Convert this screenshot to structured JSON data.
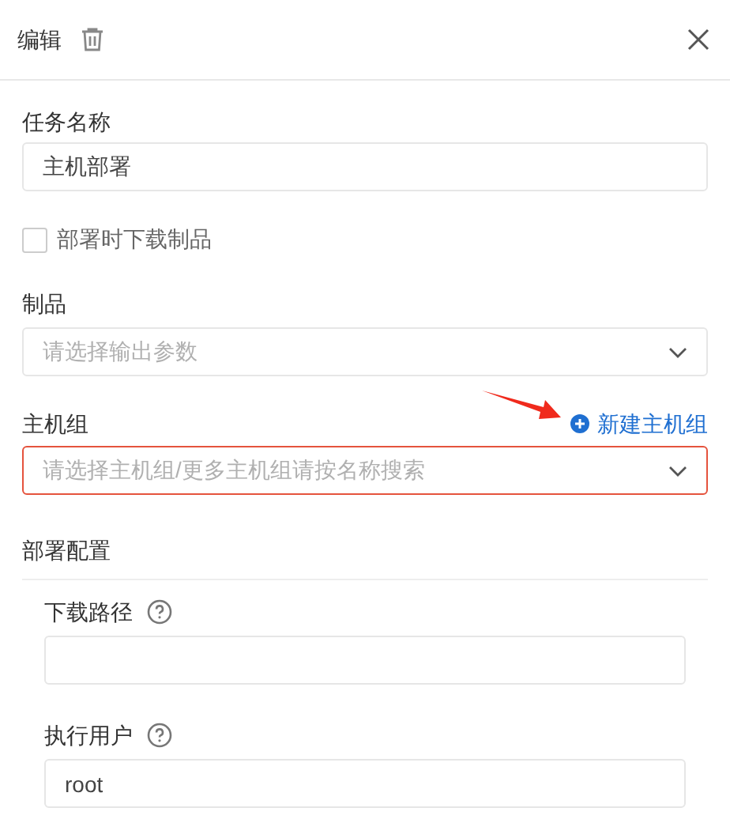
{
  "header": {
    "title": "编辑"
  },
  "task_name": {
    "label": "任务名称",
    "value": "主机部署"
  },
  "download_option": {
    "label": "部署时下载制品",
    "checked": false
  },
  "artifact": {
    "label": "制品",
    "placeholder": "请选择输出参数",
    "invalid": false
  },
  "host_group": {
    "label": "主机组",
    "placeholder": "请选择主机组/更多主机组请按名称搜索",
    "invalid": true,
    "action": "新建主机组"
  },
  "deploy_config": {
    "title": "部署配置",
    "fields": [
      {
        "label": "下载路径"
      },
      {
        "label": "执行用户",
        "value": "root"
      }
    ]
  }
}
